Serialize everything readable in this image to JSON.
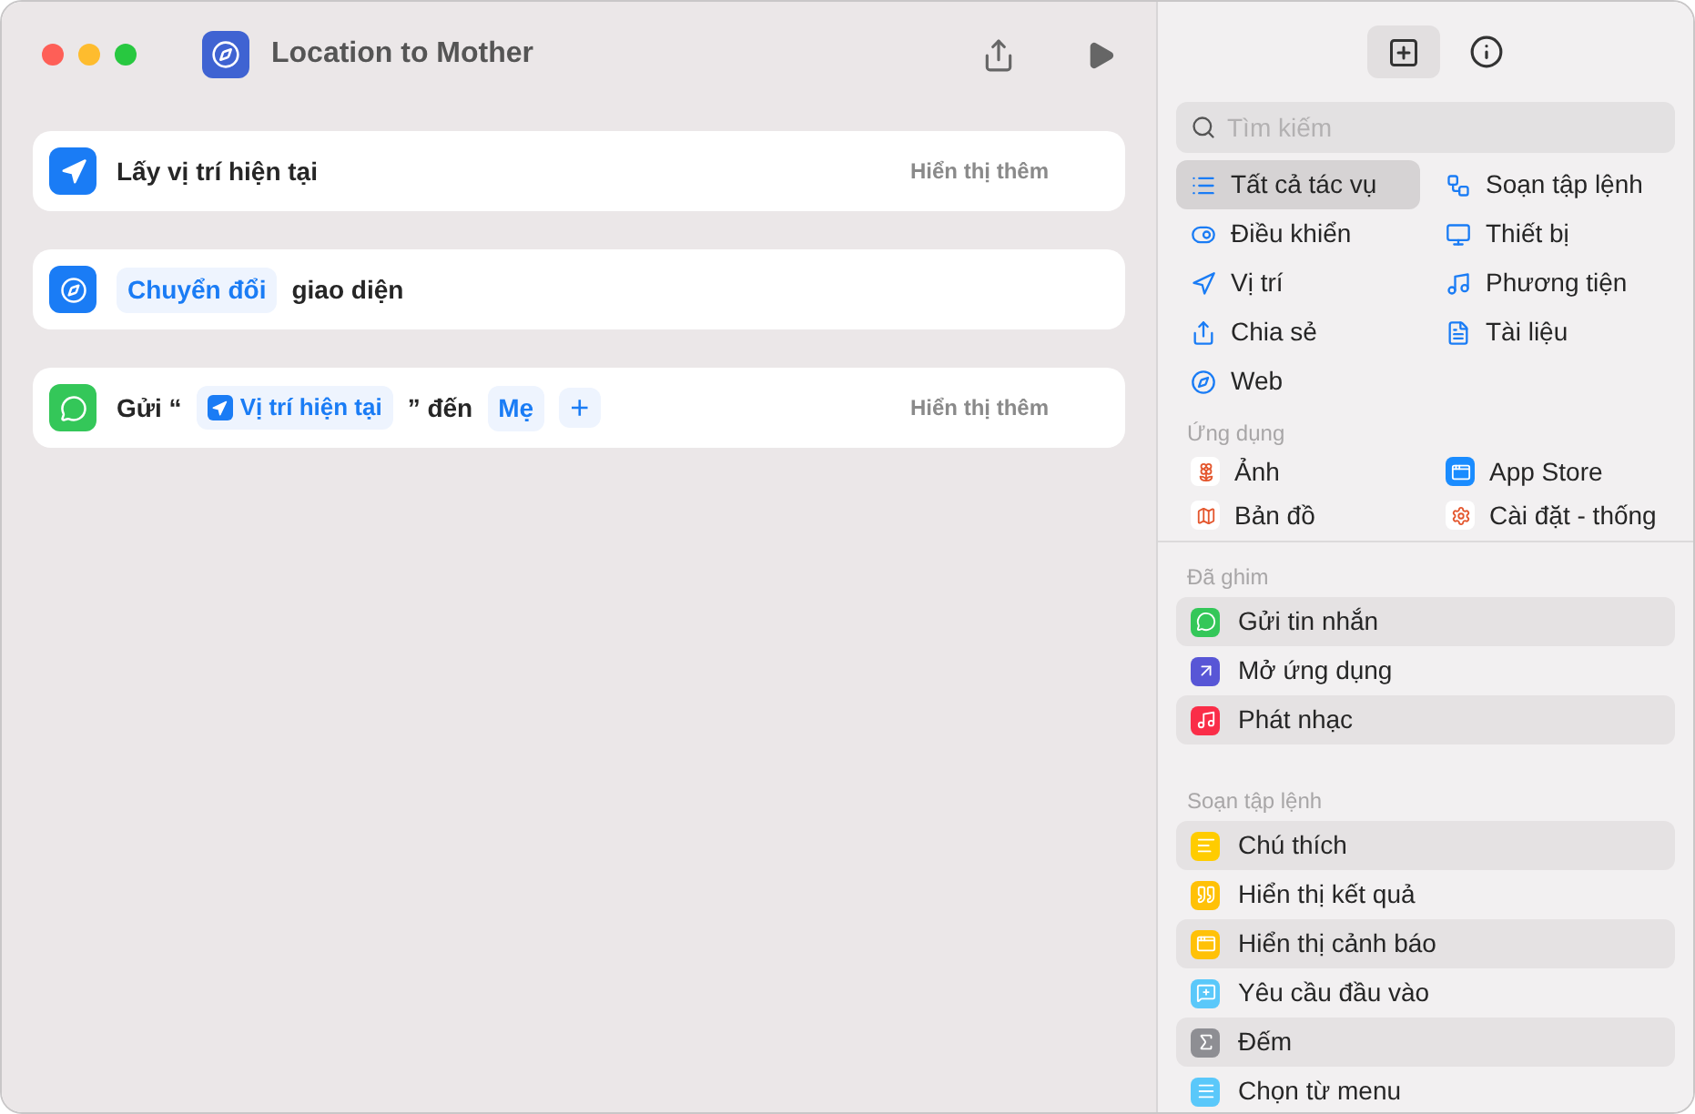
{
  "window": {
    "title": "Location to Mother"
  },
  "actions": [
    {
      "color": "#1a7cf5",
      "parts": [
        {
          "kind": "text",
          "text": "Lấy vị trí hiện tại"
        }
      ],
      "more": "Hiển thị thêm"
    },
    {
      "color": "#1a7cf5",
      "parts": [
        {
          "kind": "token",
          "text": "Chuyển đổi"
        },
        {
          "kind": "text",
          "text": "giao diện"
        }
      ]
    },
    {
      "color": "#34c759",
      "parts": [
        {
          "kind": "text",
          "text": "Gửi “"
        },
        {
          "kind": "variable",
          "text": "Vị trí hiện tại"
        },
        {
          "kind": "text",
          "text": "” đến"
        },
        {
          "kind": "token",
          "text": "Mẹ"
        },
        {
          "kind": "add",
          "text": "+"
        }
      ],
      "more": "Hiển thị thêm"
    }
  ],
  "sidebar": {
    "search": {
      "placeholder": "Tìm kiếm"
    },
    "categories": [
      {
        "label": "Tất cả tác vụ",
        "selected": true
      },
      {
        "label": "Soạn tập lệnh",
        "selected": false
      },
      {
        "label": "Điều khiển",
        "selected": false
      },
      {
        "label": "Thiết bị",
        "selected": false
      },
      {
        "label": "Vị trí",
        "selected": false
      },
      {
        "label": "Phương tiện",
        "selected": false
      },
      {
        "label": "Chia sẻ",
        "selected": false
      },
      {
        "label": "Tài liệu",
        "selected": false
      },
      {
        "label": "Web",
        "selected": false
      }
    ],
    "apps_heading": "Ứng dụng",
    "apps": [
      {
        "label": "Ảnh"
      },
      {
        "label": "App Store"
      },
      {
        "label": "Bản đồ"
      },
      {
        "label": "Cài đặt - thống"
      }
    ],
    "pinned_heading": "Đã ghim",
    "pinned": [
      {
        "label": "Gửi tin nhắn",
        "color": "#34c759"
      },
      {
        "label": "Mở ứng dụng",
        "color": "#5856d6"
      },
      {
        "label": "Phát nhạc",
        "color": "#fa2d48"
      }
    ],
    "scripting_heading": "Soạn tập lệnh",
    "scripting": [
      {
        "label": "Chú thích",
        "color": "#ffcc00"
      },
      {
        "label": "Hiển thị kết quả",
        "color": "#ffc107"
      },
      {
        "label": "Hiển thị cảnh báo",
        "color": "#ffc107"
      },
      {
        "label": "Yêu cầu đầu vào",
        "color": "#5ac8fa"
      },
      {
        "label": "Đếm",
        "color": "#8e8e93"
      },
      {
        "label": "Chọn từ menu",
        "color": "#5ac8fa"
      }
    ]
  }
}
